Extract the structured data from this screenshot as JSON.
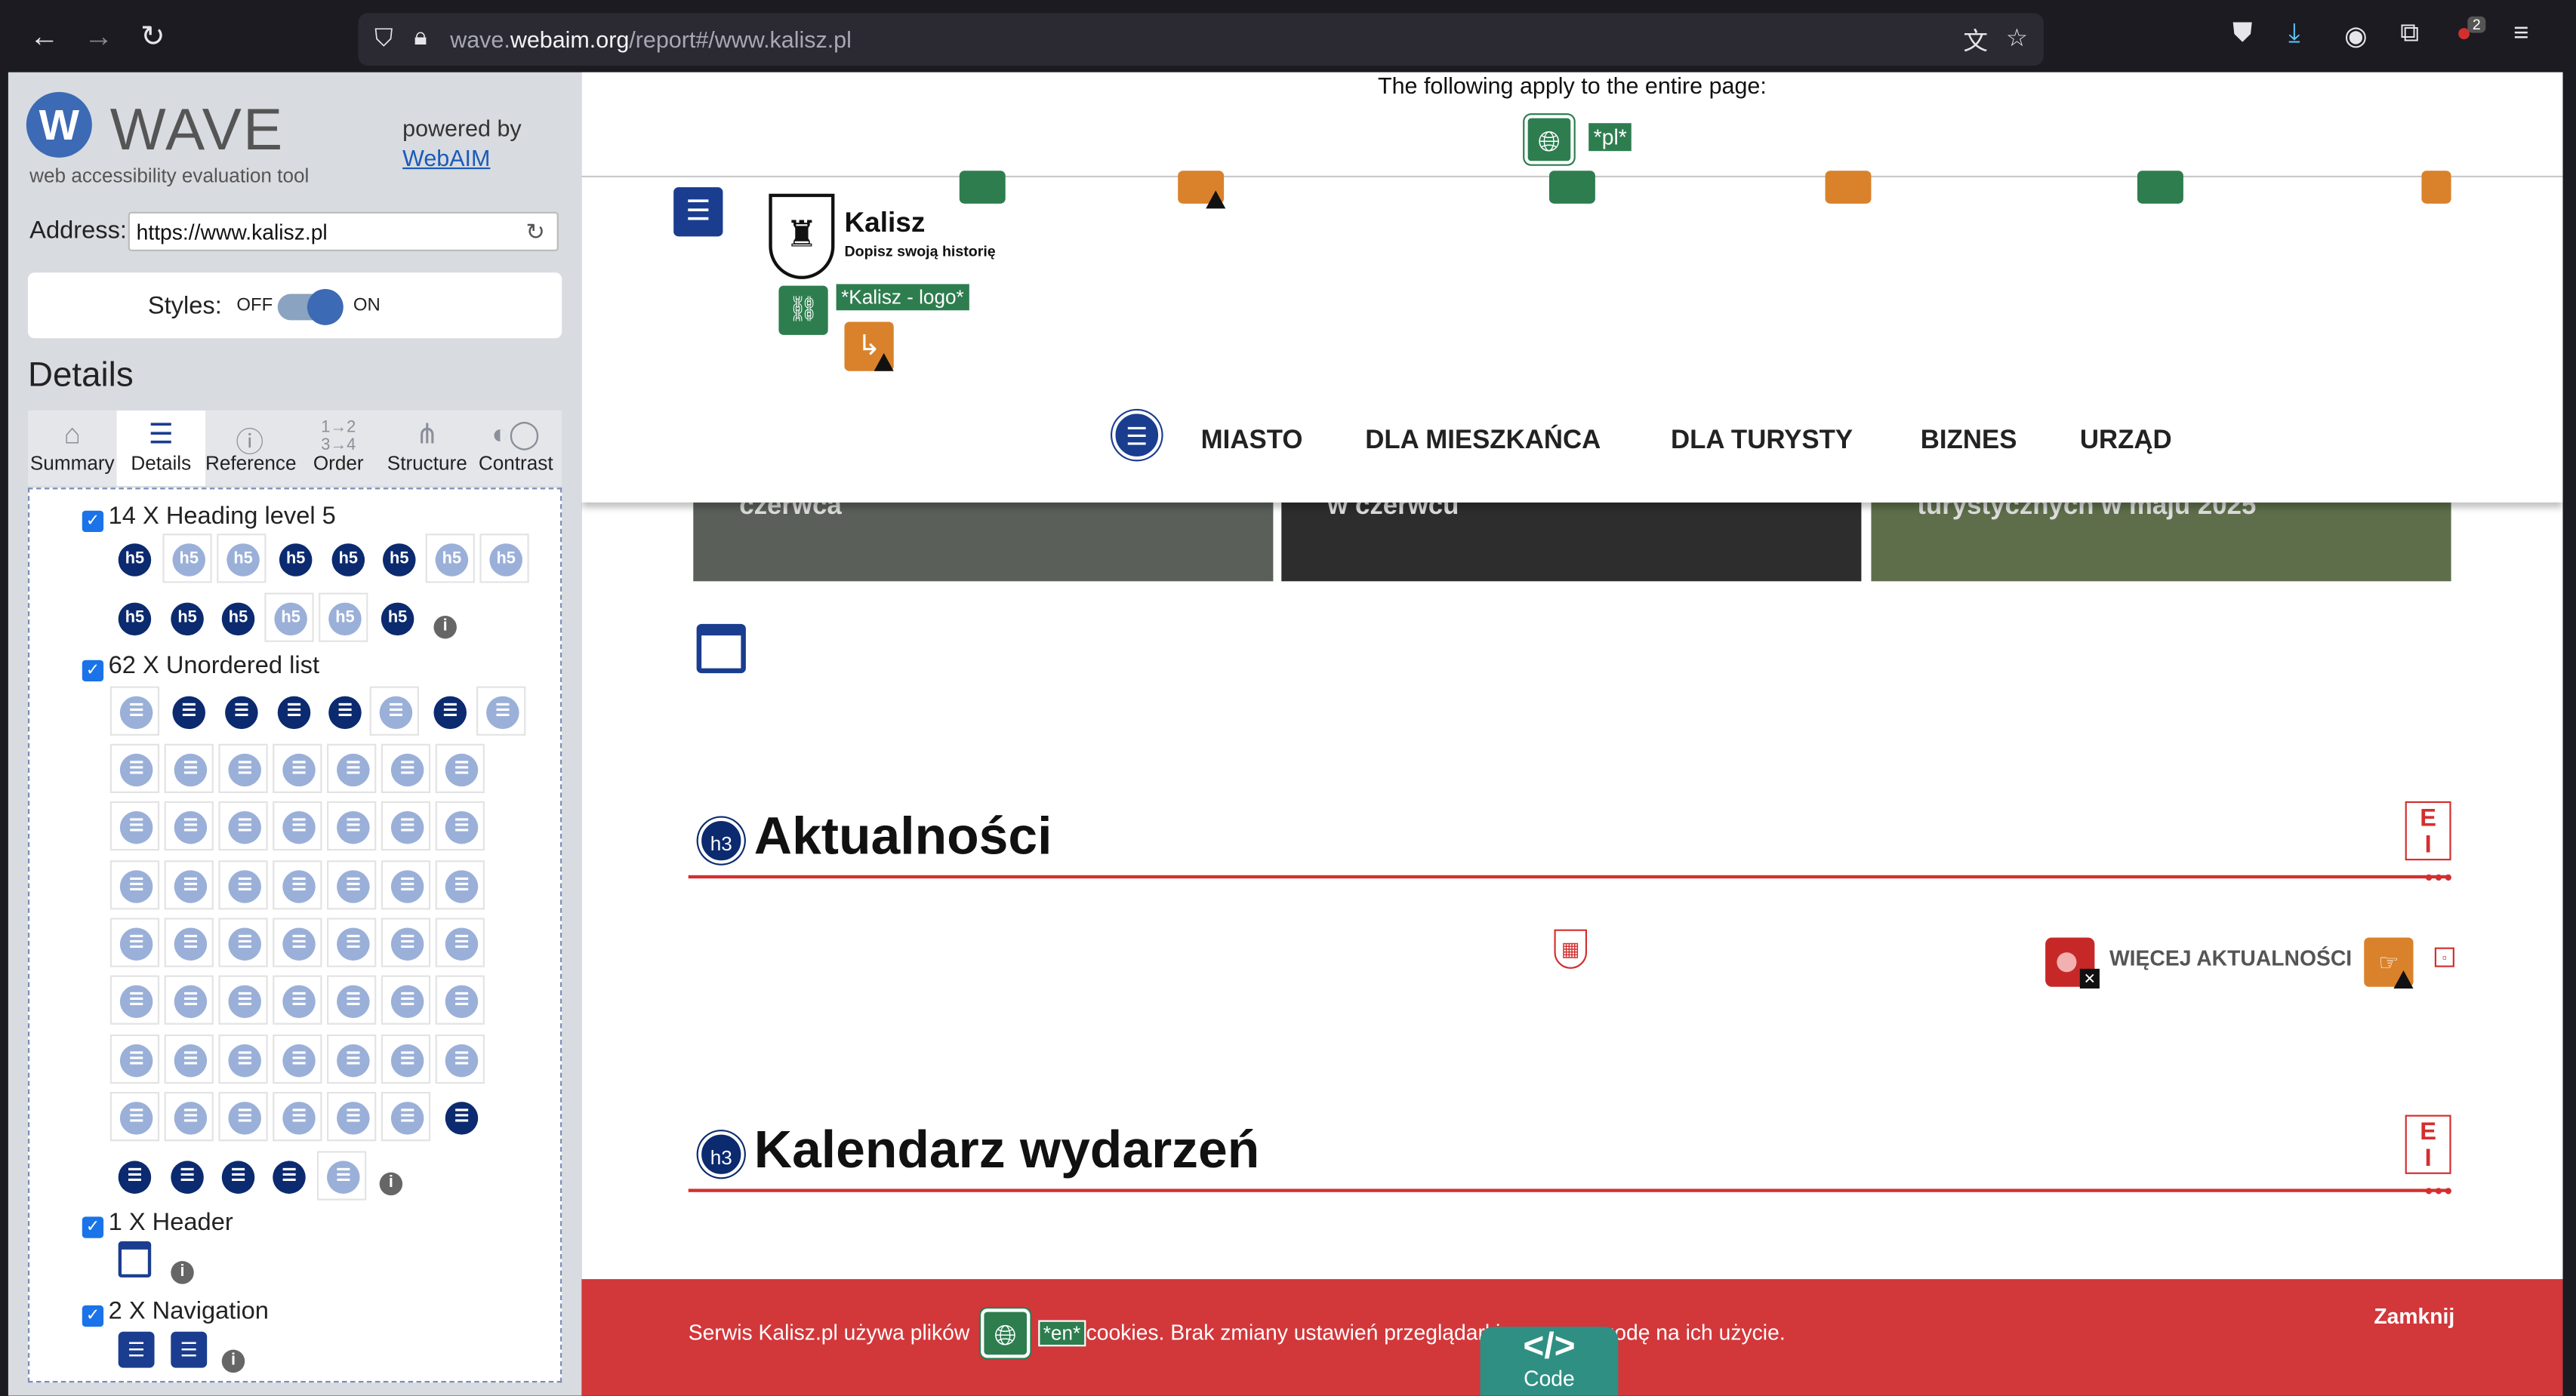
{
  "browser": {
    "url_prefix": "wave.",
    "url_domain": "webaim.org",
    "url_path": "/report#/www.kalisz.pl",
    "downloads_badge": "2"
  },
  "wave": {
    "logo_letter": "W",
    "logo_text": "WAVE",
    "tagline": "web accessibility evaluation tool",
    "powered_by": "powered by",
    "webaim_link": "WebAIM",
    "address_label": "Address:",
    "address_value": "https://www.kalisz.pl",
    "styles_label": "Styles:",
    "styles_off": "OFF",
    "styles_on": "ON",
    "details_heading": "Details",
    "tabs": [
      {
        "label": "Summary",
        "icon": "home-icon"
      },
      {
        "label": "Details",
        "icon": "list-icon"
      },
      {
        "label": "Reference",
        "icon": "info-icon"
      },
      {
        "label": "Order",
        "icon": "order-icon"
      },
      {
        "label": "Structure",
        "icon": "structure-icon"
      },
      {
        "label": "Contrast",
        "icon": "contrast-icon"
      }
    ],
    "categories": [
      {
        "label": "14 X Heading level 5",
        "icon_text": "h5"
      },
      {
        "label": "62 X Unordered list"
      },
      {
        "label": "1 X Header"
      },
      {
        "label": "2 X Navigation"
      }
    ]
  },
  "page": {
    "notice": "The following apply to the entire page:",
    "lang_label": "*pl*",
    "brand_name": "Kalisz",
    "brand_sub": "Dopisz swoją historię",
    "logo_alt": "*Kalisz - logo*",
    "menu": [
      "MIASTO",
      "DLA MIESZKAŃCA",
      "DLA TURYSTY",
      "BIZNES",
      "URZĄD"
    ],
    "photo_captions": [
      "czerwca",
      "w czerwcu",
      "turystycznych w maju 2025"
    ],
    "sections": [
      {
        "badge": "h3",
        "title": "Aktualności"
      },
      {
        "badge": "h3",
        "title": "Kalendarz wydarzeń"
      }
    ],
    "more_news": "WIĘCEJ AKTUALNOŚCI",
    "cookie_text_before": "Serwis Kalisz.pl używa plików",
    "cookie_lang_label": "*en*",
    "cookie_text_after": "cookies. Brak zmiany ustawień przeglądarki oznacza zgodę na ich użycie.",
    "cookie_close": "Zamknij",
    "code_glyph": "</>",
    "code_label": "Code"
  },
  "colors": {
    "wave_blue": "#1a3d8f",
    "feature_green": "#2e7d4f",
    "alert_orange": "#d9822b",
    "error_red": "#c62828",
    "cookie_red": "#d2373a"
  }
}
